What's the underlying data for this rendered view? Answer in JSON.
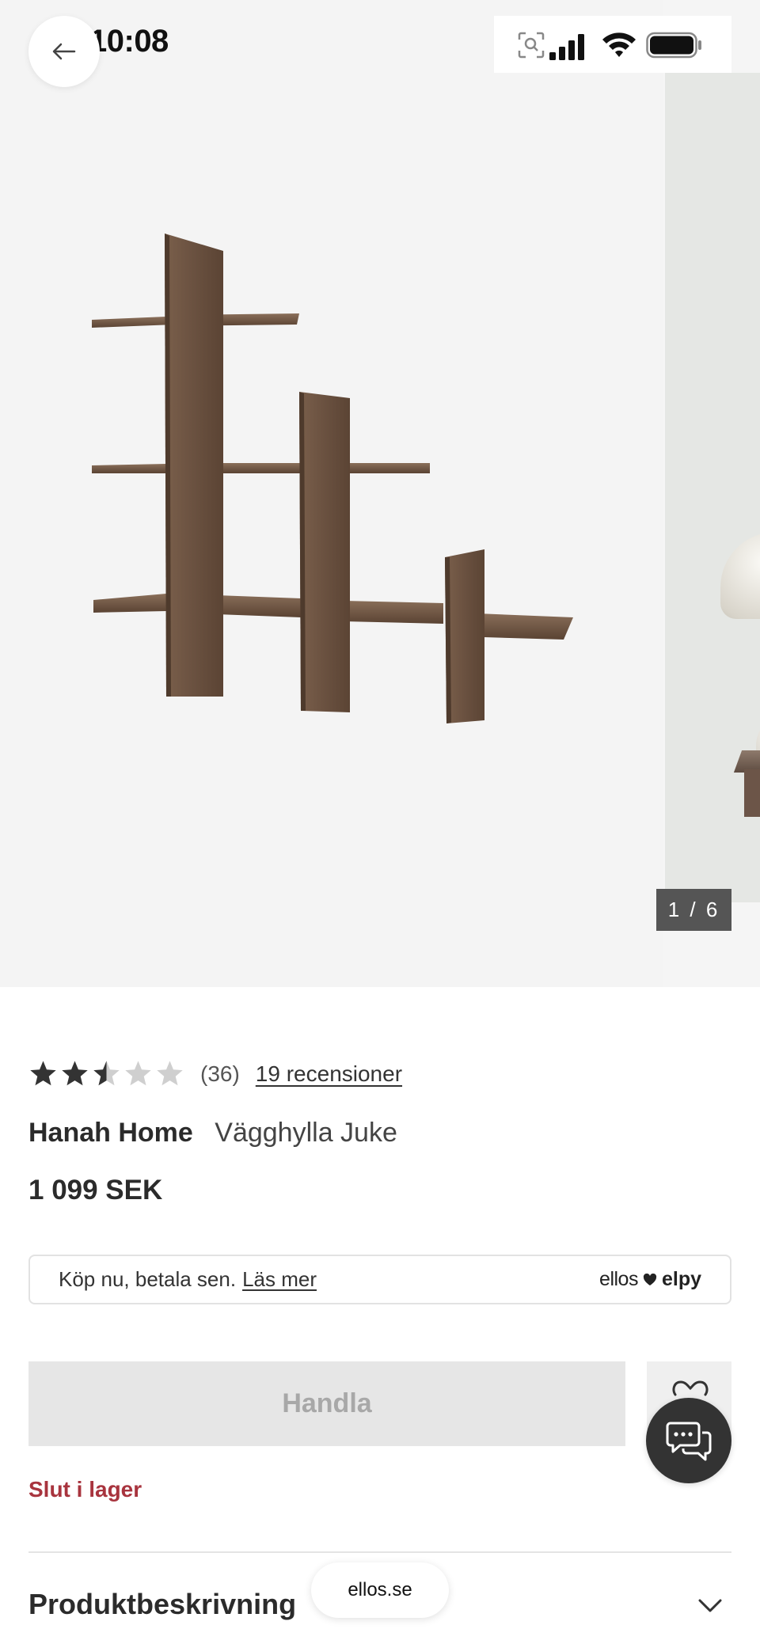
{
  "status_bar": {
    "time": "10:08"
  },
  "gallery": {
    "counter": "1 / 6",
    "current": 1,
    "total": 6,
    "background": "#f4f4f4",
    "wood_color": "#6b5240"
  },
  "product": {
    "rating": 2.5,
    "rating_max": 5,
    "rating_count": "(36)",
    "reviews_link": "19 recensioner",
    "brand": "Hanah Home",
    "name": "Vägghylla Juke",
    "price": "1 099 SEK"
  },
  "payment": {
    "text": "Köp nu, betala sen.",
    "link": "Läs mer",
    "logo_ellos": "ellos",
    "logo_elpy": "elpy"
  },
  "actions": {
    "buy_label": "Handla",
    "stock_status": "Slut i lager"
  },
  "sections": {
    "description_title": "Produktbeskrivning"
  },
  "browser": {
    "url": "ellos.se"
  },
  "colors": {
    "out_of_stock": "#a8343e",
    "chat_button": "#333333",
    "buy_disabled_bg": "#e6e6e6"
  }
}
